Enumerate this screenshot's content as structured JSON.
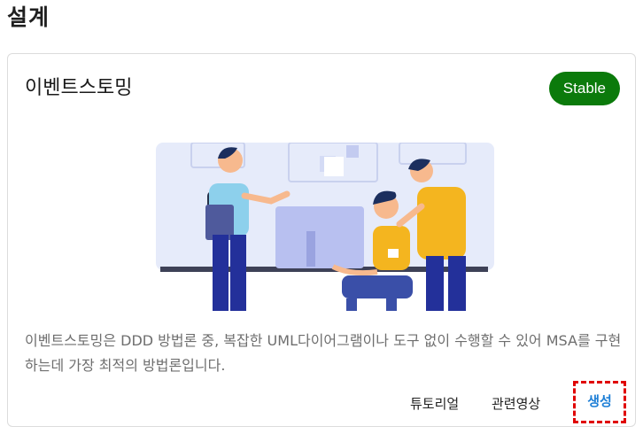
{
  "section": {
    "title": "설계"
  },
  "card": {
    "title": "이벤트스토밍",
    "badge": "Stable",
    "badge_color": "#0b7a0b",
    "description": "이벤트스토밍은 DDD 방법론 중, 복잡한 UML다이어그램이나 도구 없이 수행할 수 있어 MSA를 구현하는데 가장 최적의 방법론입니다.",
    "illustration_icon": "team-working-illustration",
    "actions": {
      "tutorial": "튜토리얼",
      "video": "관련영상",
      "create": "생성"
    },
    "accent_color": "#1e7fd6"
  }
}
